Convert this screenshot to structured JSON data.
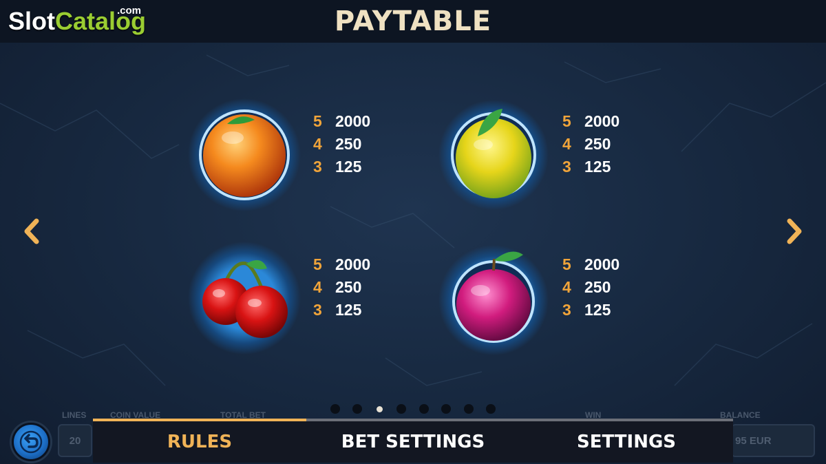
{
  "watermark": {
    "slot": "Slot",
    "catalog": "Catalog",
    "com": ".com"
  },
  "header": {
    "title": "PAYTABLE"
  },
  "nav": {
    "prev_icon": "chevron-left-icon",
    "next_icon": "chevron-right-icon"
  },
  "symbols": [
    {
      "name": "orange",
      "pays": [
        {
          "count": "5",
          "value": "2000"
        },
        {
          "count": "4",
          "value": "250"
        },
        {
          "count": "3",
          "value": "125"
        }
      ]
    },
    {
      "name": "lemon",
      "pays": [
        {
          "count": "5",
          "value": "2000"
        },
        {
          "count": "4",
          "value": "250"
        },
        {
          "count": "3",
          "value": "125"
        }
      ]
    },
    {
      "name": "cherries",
      "pays": [
        {
          "count": "5",
          "value": "2000"
        },
        {
          "count": "4",
          "value": "250"
        },
        {
          "count": "3",
          "value": "125"
        }
      ]
    },
    {
      "name": "plum",
      "pays": [
        {
          "count": "5",
          "value": "2000"
        },
        {
          "count": "4",
          "value": "250"
        },
        {
          "count": "3",
          "value": "125"
        }
      ]
    }
  ],
  "pagination": {
    "total_pages": 8,
    "current_page": 3
  },
  "hud_background": {
    "lines_label": "LINES",
    "lines_value": "20",
    "coin_value_label": "COIN VALUE",
    "total_bet_label": "TOTAL BET",
    "win_label": "WIN",
    "balance_label": "BALANCE",
    "balance_value": "95 EUR"
  },
  "back_button": {
    "icon": "back-arrow-icon"
  },
  "tabs": {
    "items": [
      {
        "label": "RULES"
      },
      {
        "label": "BET SETTINGS"
      },
      {
        "label": "SETTINGS"
      }
    ],
    "active_index": 0,
    "progress_fraction": 0.333
  },
  "colors": {
    "accent": "#f0b357",
    "count": "#f0a43a",
    "value": "#ffffff",
    "title": "#efe1c2",
    "background": "#182a42"
  }
}
